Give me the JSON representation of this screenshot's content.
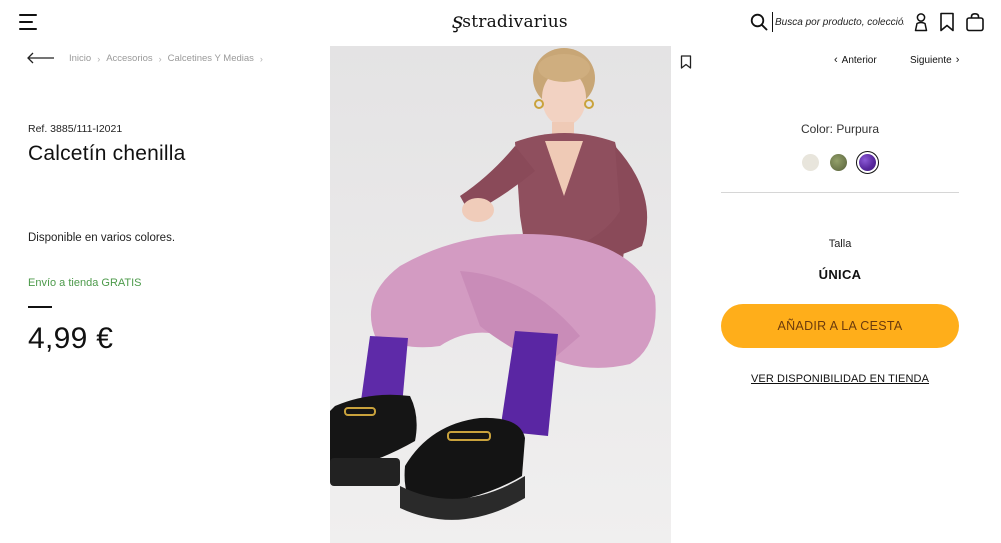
{
  "header": {
    "brand": "stradivarius",
    "brand_mark": "ş",
    "search_placeholder": "Busca por producto, colección...",
    "icons": [
      "menu-icon",
      "search-icon",
      "user-icon",
      "wishlist-icon",
      "shopping-bag-icon"
    ]
  },
  "breadcrumb": {
    "items": [
      "Inicio",
      "Accesorios",
      "Calcetines Y Medias"
    ],
    "separator": "›"
  },
  "product": {
    "ref": "Ref. 3885/111-I2021",
    "title": "Calcetín chenilla",
    "availability_note": "Disponible en varios colores.",
    "shipping": "Envío a tienda GRATIS",
    "price": "4,99 €"
  },
  "navigation": {
    "prev_label": "Anterior",
    "next_label": "Siguiente"
  },
  "color": {
    "label": "Color: Purpura",
    "options": [
      {
        "name": "beige",
        "hex": "#e8e5dc",
        "selected": false
      },
      {
        "name": "khaki",
        "hex": "#6f7a4d",
        "selected": false
      },
      {
        "name": "purpura",
        "hex": "#5a2aa0",
        "selected": true
      }
    ]
  },
  "size": {
    "label": "Talla",
    "value": "ÚNICA"
  },
  "actions": {
    "add_to_cart": "AÑADIR A LA CESTA",
    "store_availability": "VER DISPONIBILIDAD EN TIENDA"
  },
  "colors": {
    "cta": "#ffae1a",
    "cta_text": "#6b3a0d",
    "shipping_green": "#4c9a4a"
  }
}
